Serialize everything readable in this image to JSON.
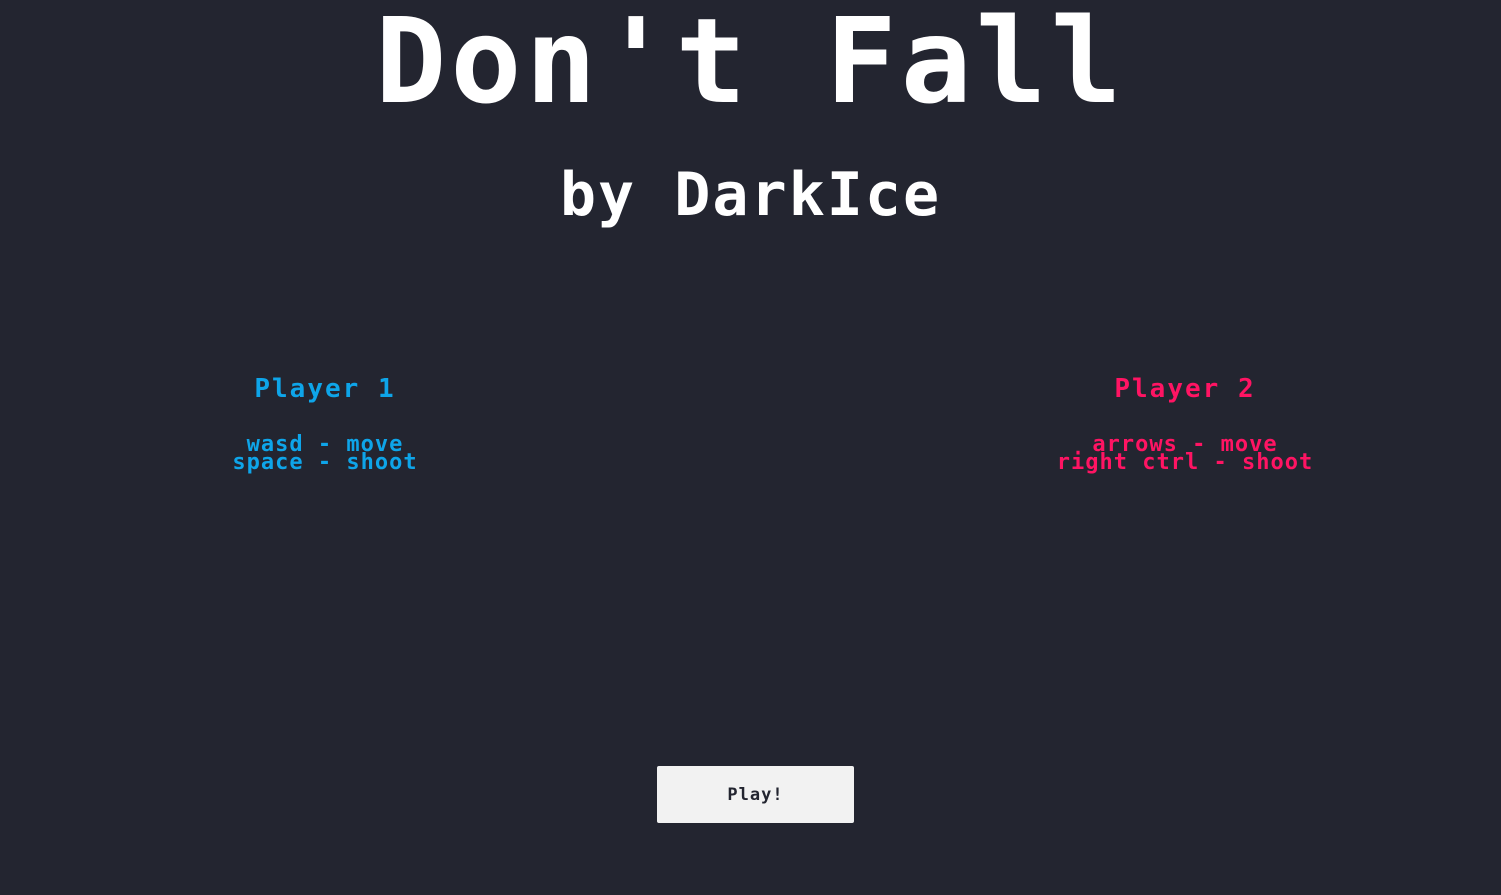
{
  "title": "Don't Fall",
  "subtitle": "by DarkIce",
  "players": [
    {
      "heading": "Player 1",
      "color": "#0ea5e9",
      "controls": [
        "wasd - move",
        "space - shoot"
      ]
    },
    {
      "heading": "Player 2",
      "color": "#ff1463",
      "controls": [
        "arrows - move",
        "right ctrl - shoot"
      ]
    }
  ],
  "play_button": {
    "label": "Play!"
  },
  "colors": {
    "background": "#232530",
    "title": "#ffffff",
    "button_bg": "#f2f2f2",
    "button_text": "#232530"
  }
}
